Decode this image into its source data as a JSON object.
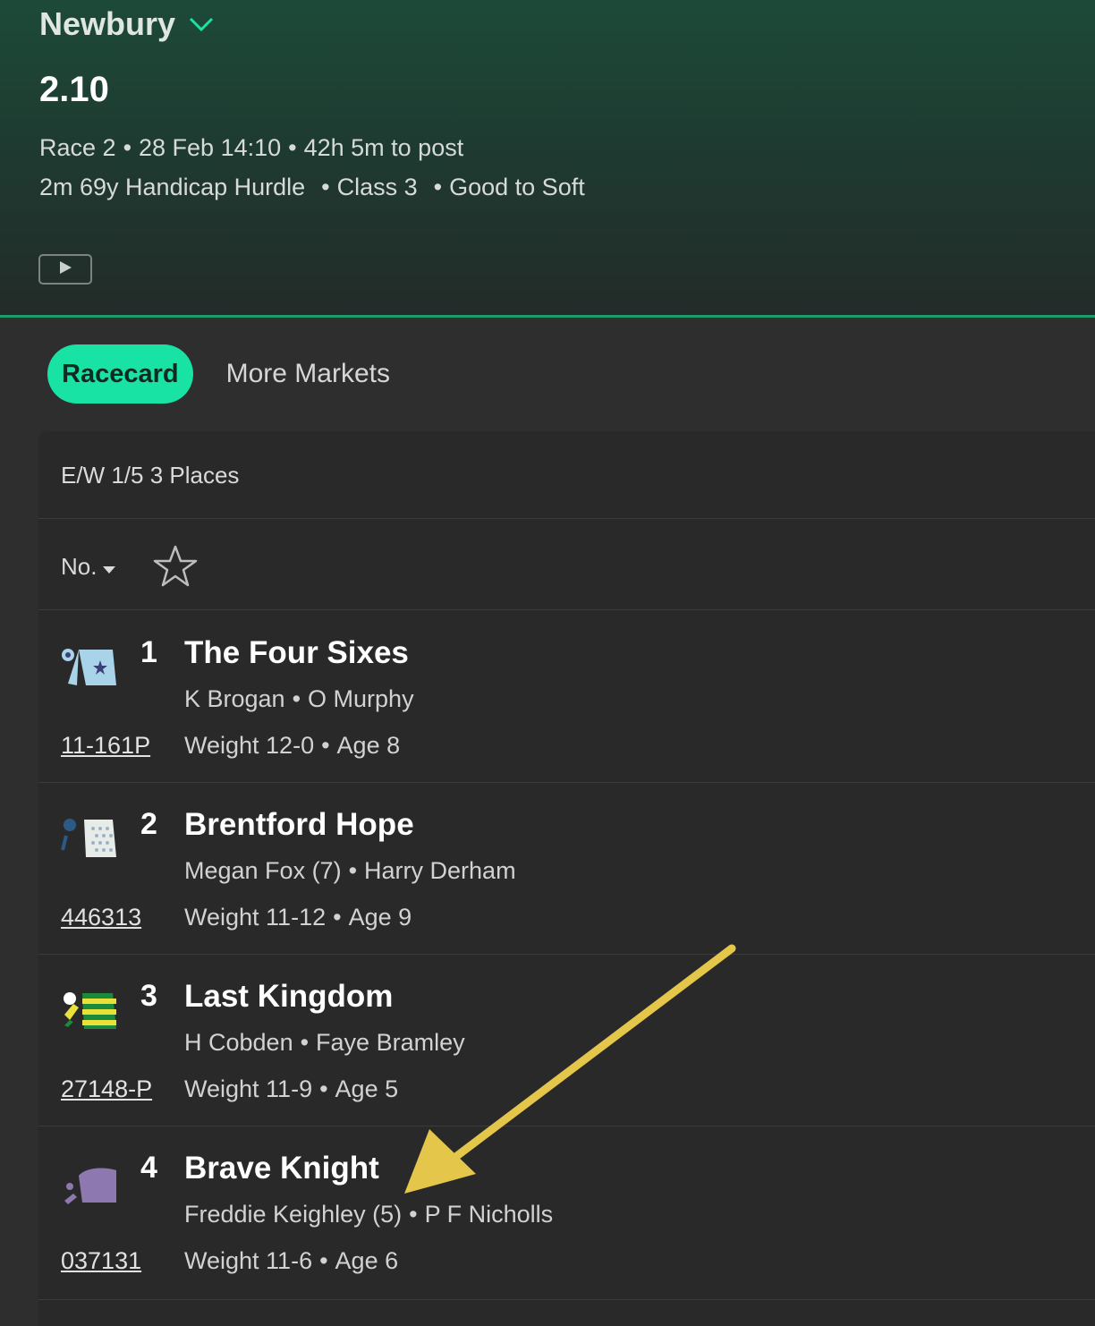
{
  "header": {
    "venue": "Newbury",
    "race_time": "2.10",
    "race_number": "Race 2",
    "datetime": "28 Feb 14:10",
    "countdown": "42h 5m to post",
    "distance_type": "2m 69y Handicap Hurdle",
    "class": "Class 3",
    "going": "Good to Soft",
    "icons": {
      "venue_dropdown": "chevron-down-icon",
      "video": "play-icon"
    }
  },
  "tabs": [
    {
      "label": "Racecard",
      "active": true
    },
    {
      "label": "More Markets",
      "active": false
    }
  ],
  "card": {
    "each_way_terms": "E/W 1/5 3 Places",
    "sort_label": "No.",
    "runners": [
      {
        "number": "1",
        "name": "The Four Sixes",
        "jockey": "K Brogan",
        "trainer": "O Murphy",
        "form": "11-161P",
        "weight": "Weight 12-0",
        "age": "Age 8",
        "silk_colors": [
          "#a9d3e8",
          "#3a3f78"
        ]
      },
      {
        "number": "2",
        "name": "Brentford Hope",
        "jockey": "Megan Fox (7)",
        "trainer": "Harry Derham",
        "form": "446313",
        "weight": "Weight 11-12",
        "age": "Age 9",
        "silk_colors": [
          "#e8ece9",
          "#2c5a86"
        ]
      },
      {
        "number": "3",
        "name": "Last Kingdom",
        "jockey": "H Cobden",
        "trainer": "Faye Bramley",
        "form": "27148-P",
        "weight": "Weight 11-9",
        "age": "Age 5",
        "silk_colors": [
          "#e9e13a",
          "#1b8a3a"
        ]
      },
      {
        "number": "4",
        "name": "Brave Knight",
        "jockey": "Freddie Keighley (5)",
        "trainer": "P F Nicholls",
        "form": "037131",
        "weight": "Weight 11-6",
        "age": "Age 6",
        "silk_colors": [
          "#8e78b0"
        ]
      }
    ]
  },
  "colors": {
    "accent": "#19e3a4",
    "annotation_arrow": "#e3c64a"
  }
}
